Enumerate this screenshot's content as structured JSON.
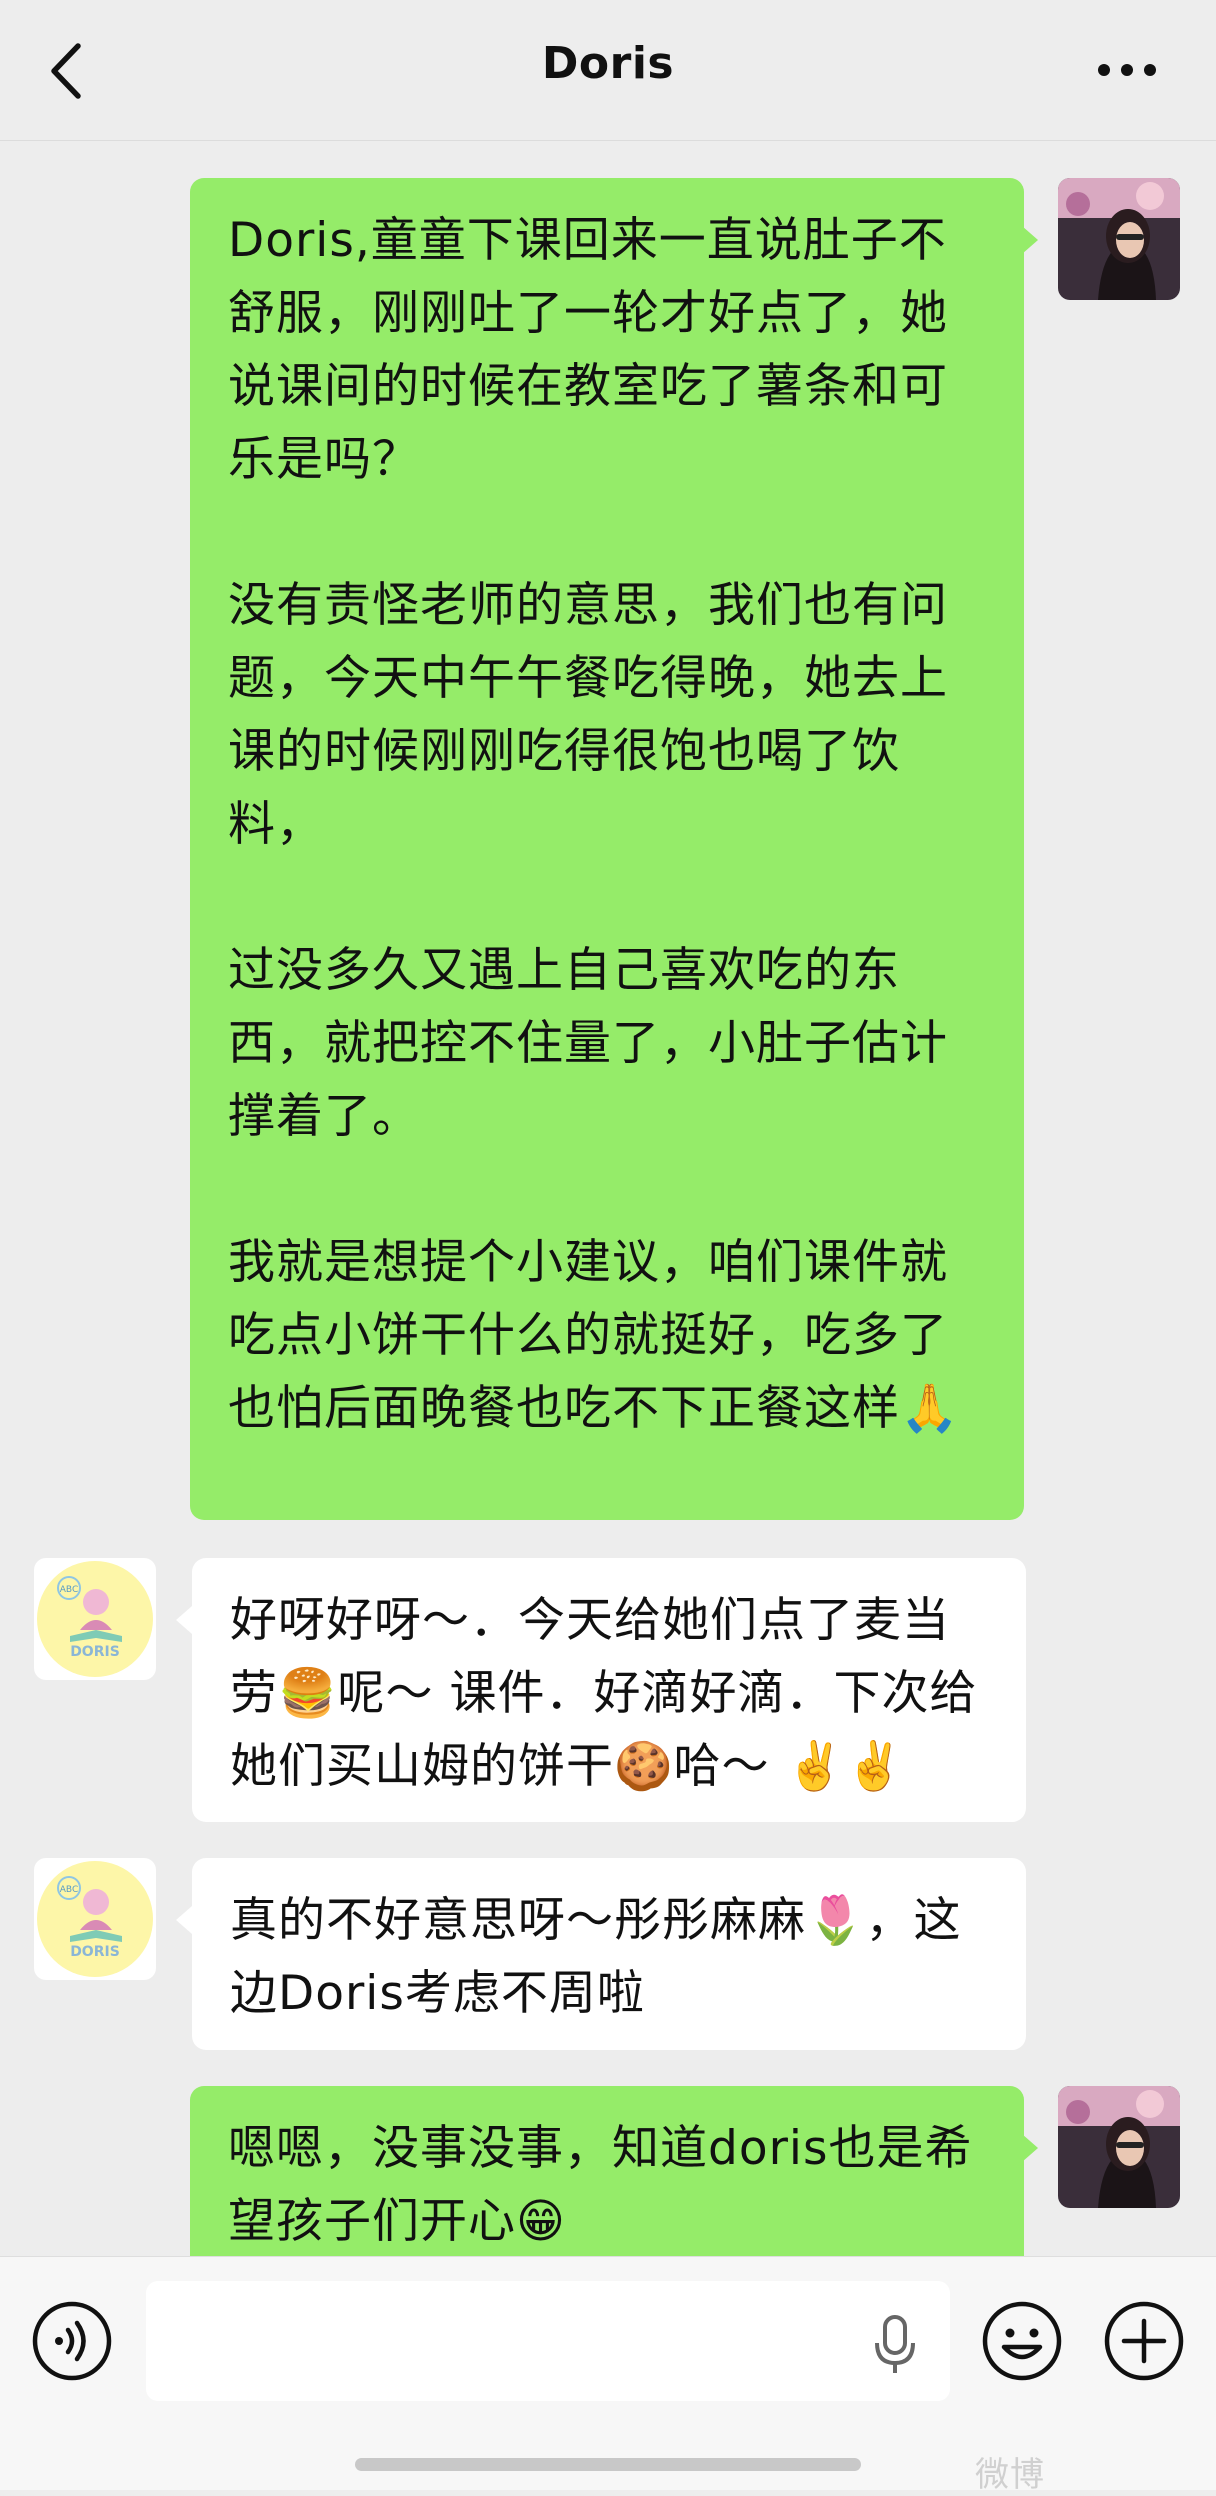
{
  "header": {
    "title": "Doris",
    "back_icon": "chevron-left-icon",
    "more_icon": "more-horizontal-icon"
  },
  "messages": [
    {
      "direction": "outgoing",
      "text": "Doris,童童下课回来一直说肚子不舒服，刚刚吐了一轮才好点了，她说课间的时候在教室吃了薯条和可乐是吗？\n\n没有责怪老师的意思，我们也有问题，今天中午午餐吃得晚，她去上课的时候刚刚吃得很饱也喝了饮料，\n\n过没多久又遇上自己喜欢吃的东西，就把控不住量了，小肚子估计撑着了。\n\n我就是想提个小建议，咱们课件就吃点小饼干什么的就挺好，吃多了也怕后面晚餐也吃不下正餐这样🙏"
    },
    {
      "direction": "incoming",
      "text": "好呀好呀～．今天给她们点了麦当劳🍔呢～ 课件．好滴好滴．下次给她们买山姆的饼干🍪哈～ ✌️✌️"
    },
    {
      "direction": "incoming",
      "text": "真的不好意思呀～彤彤麻麻🌷，这边Doris考虑不周啦"
    },
    {
      "direction": "outgoing",
      "text": "嗯嗯，没事没事，知道doris也是希望孩子们开心😁"
    }
  ],
  "avatars": {
    "self": "user-photo-avatar",
    "contact": "doris-logo-avatar",
    "contact_logo_text": "DORIS",
    "contact_logo_abc": "ABC"
  },
  "input_bar": {
    "placeholder": "",
    "voice_icon": "voice-input-icon",
    "mic_icon": "microphone-icon",
    "emoji_icon": "emoji-icon",
    "plus_icon": "plus-icon"
  },
  "watermark": "微博"
}
